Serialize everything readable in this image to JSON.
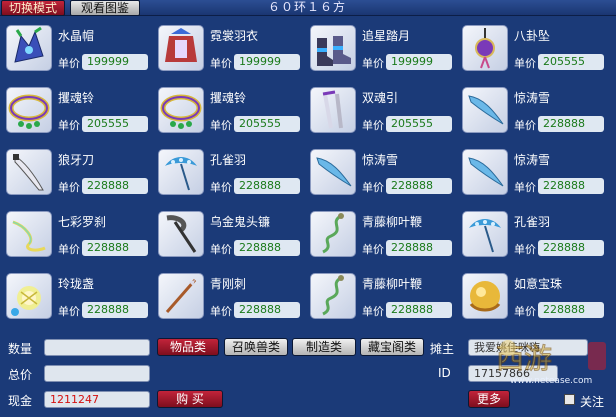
{
  "tabs": [
    {
      "label": "切换模式",
      "active": true
    },
    {
      "label": "观看图鉴",
      "active": false
    }
  ],
  "shop_title": "６０环１６方",
  "price_label": "单价",
  "items": [
    {
      "name": "水晶帽",
      "price": "199999",
      "icon": "crystal-hat-icon"
    },
    {
      "name": "霓裳羽衣",
      "price": "199999",
      "icon": "feather-robe-icon"
    },
    {
      "name": "追星踏月",
      "price": "199999",
      "icon": "boots-icon"
    },
    {
      "name": "八卦坠",
      "price": "205555",
      "icon": "bagua-pendant-icon"
    },
    {
      "name": "攫魂铃",
      "price": "205555",
      "icon": "soul-bell-ring-icon"
    },
    {
      "name": "攫魂铃",
      "price": "205555",
      "icon": "soul-bell-ring-icon"
    },
    {
      "name": "双魂引",
      "price": "205555",
      "icon": "twin-soul-weapon-icon"
    },
    {
      "name": "惊涛雪",
      "price": "228888",
      "icon": "wave-blade-icon"
    },
    {
      "name": "狼牙刀",
      "price": "228888",
      "icon": "wolf-fang-blade-icon"
    },
    {
      "name": "孔雀羽",
      "price": "228888",
      "icon": "peacock-fan-icon"
    },
    {
      "name": "惊涛雪",
      "price": "228888",
      "icon": "wave-blade-icon"
    },
    {
      "name": "惊涛雪",
      "price": "228888",
      "icon": "wave-blade-icon"
    },
    {
      "name": "七彩罗刹",
      "price": "228888",
      "icon": "rainbow-whip-icon"
    },
    {
      "name": "乌金鬼头镰",
      "price": "228888",
      "icon": "scythe-icon"
    },
    {
      "name": "青藤柳叶鞭",
      "price": "228888",
      "icon": "vine-whip-icon"
    },
    {
      "name": "孔雀羽",
      "price": "228888",
      "icon": "peacock-fan-icon"
    },
    {
      "name": "玲珑盏",
      "price": "228888",
      "icon": "lantern-cup-icon"
    },
    {
      "name": "青刚刺",
      "price": "228888",
      "icon": "spear-icon"
    },
    {
      "name": "青藤柳叶鞭",
      "price": "228888",
      "icon": "vine-whip-icon"
    },
    {
      "name": "如意宝珠",
      "price": "228888",
      "icon": "ruyi-pearl-icon"
    }
  ],
  "bottom": {
    "quantity_label": "数量",
    "total_label": "总价",
    "cash_label": "现金",
    "cash_value": "1211247",
    "buy_label": "购 买",
    "categories": [
      {
        "label": "物品类",
        "active": true
      },
      {
        "label": "召唤兽类",
        "active": false
      },
      {
        "label": "制造类",
        "active": false
      },
      {
        "label": "藏宝阁类",
        "active": false
      }
    ],
    "owner_label": "摊主",
    "owner_value": "我爱姚佳咪嗨",
    "id_label": "ID",
    "id_value": "17157866",
    "more_label": "更多",
    "follow_label": "关注"
  },
  "watermark": {
    "url_text": "www.netease.com"
  },
  "colors": {
    "background": "#1b3a78",
    "active_button": "#a81a2e",
    "price_text": "#1a7a1a",
    "cash_text": "#d41010"
  }
}
